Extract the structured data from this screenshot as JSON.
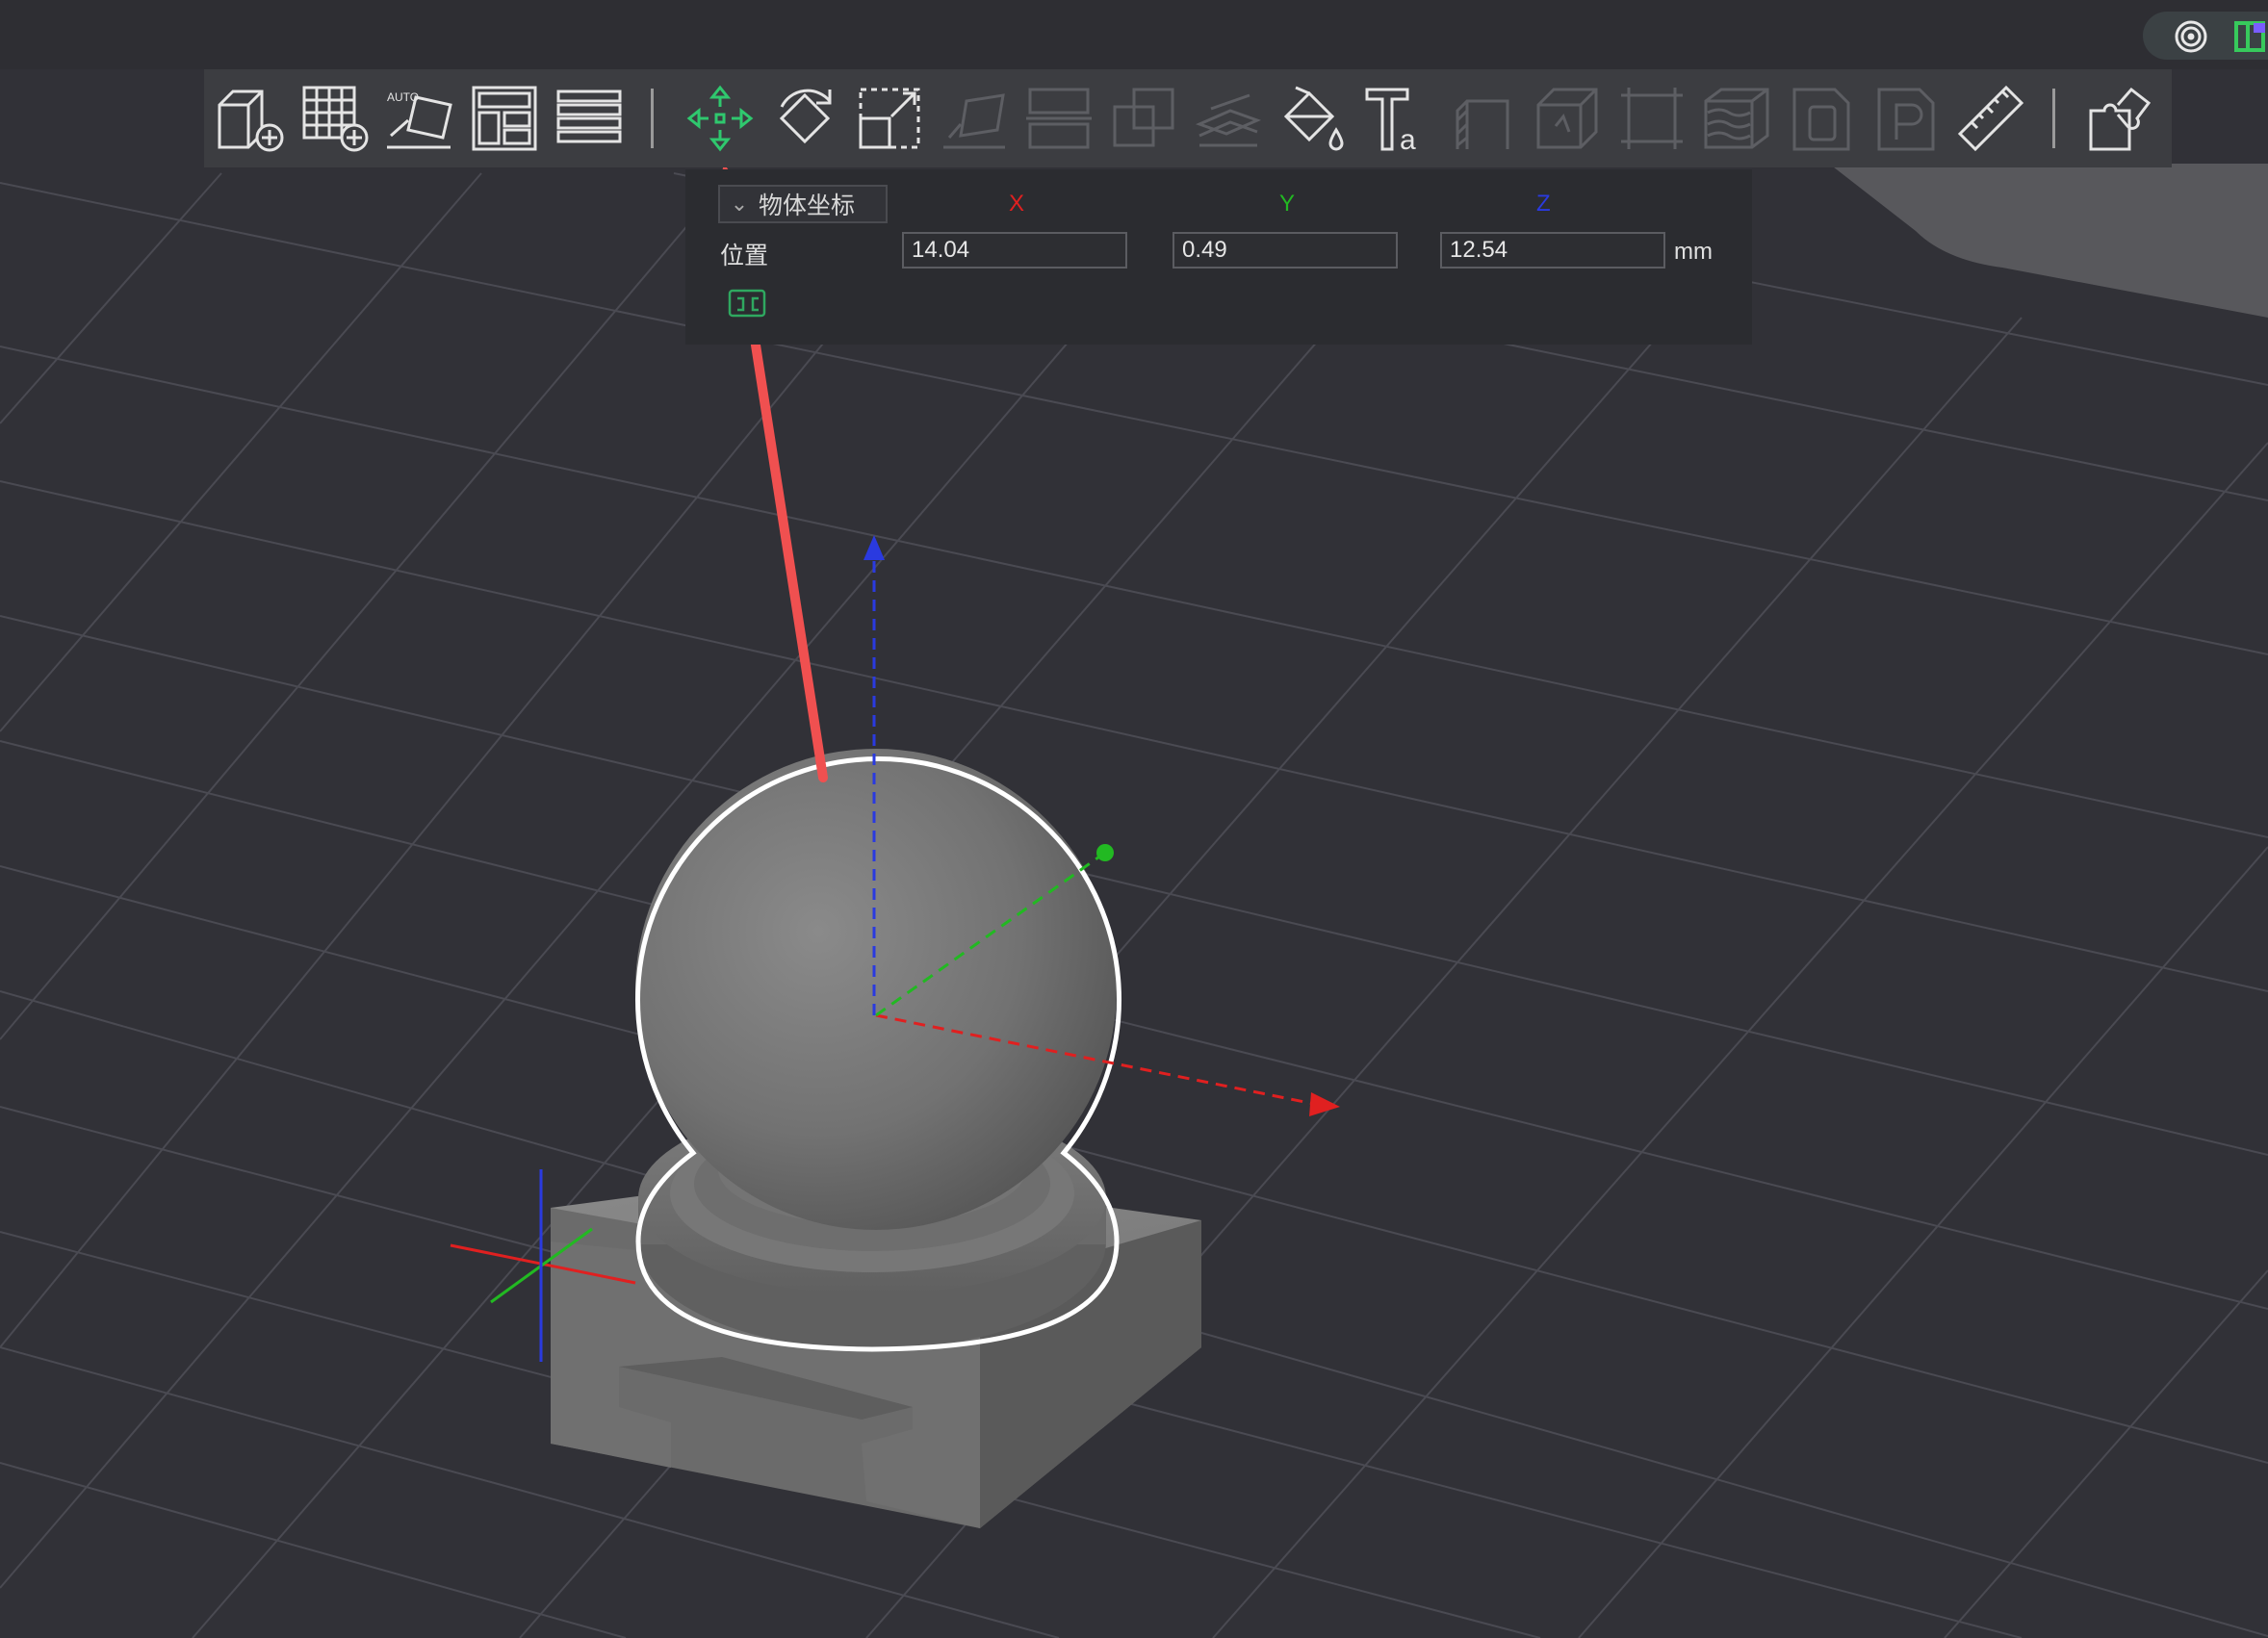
{
  "toolbar": {
    "tools": [
      {
        "name": "add-model-icon"
      },
      {
        "name": "add-grid-icon"
      },
      {
        "name": "auto-layout-icon",
        "badge": "AUTO"
      },
      {
        "name": "arrange-icon"
      },
      {
        "name": "layers-icon"
      },
      {
        "name": "move-icon",
        "active": true
      },
      {
        "name": "rotate-icon"
      },
      {
        "name": "scale-icon"
      },
      {
        "name": "lay-flat-icon",
        "disabled": true
      },
      {
        "name": "split-icon",
        "disabled": true
      },
      {
        "name": "boolean-icon",
        "disabled": true
      },
      {
        "name": "cut-icon",
        "disabled": true
      },
      {
        "name": "paint-icon"
      },
      {
        "name": "text-icon"
      },
      {
        "name": "support-icon",
        "disabled": true
      },
      {
        "name": "hollow-icon",
        "disabled": true
      },
      {
        "name": "mesh-repair-icon",
        "disabled": true
      },
      {
        "name": "height-range-icon",
        "disabled": true
      },
      {
        "name": "drill-icon",
        "disabled": true
      },
      {
        "name": "pin-icon",
        "disabled": true
      },
      {
        "name": "measure-icon"
      },
      {
        "name": "assembly-icon"
      }
    ]
  },
  "coord_panel": {
    "mode_label": "物体坐标",
    "position_label": "位置",
    "axes": {
      "x": "X",
      "y": "Y",
      "z": "Z"
    },
    "x_value": "14.04",
    "y_value": "0.49",
    "z_value": "12.54",
    "unit": "mm"
  },
  "colors": {
    "background": "#313137",
    "toolbar_bg": "#3c3d41",
    "active_tool": "#2fc86e",
    "axis_x": "#e02020",
    "axis_y": "#22b922",
    "axis_z": "#2a3ae0",
    "annotation_arrow": "#f05050",
    "selection_outline": "#ffffff"
  }
}
